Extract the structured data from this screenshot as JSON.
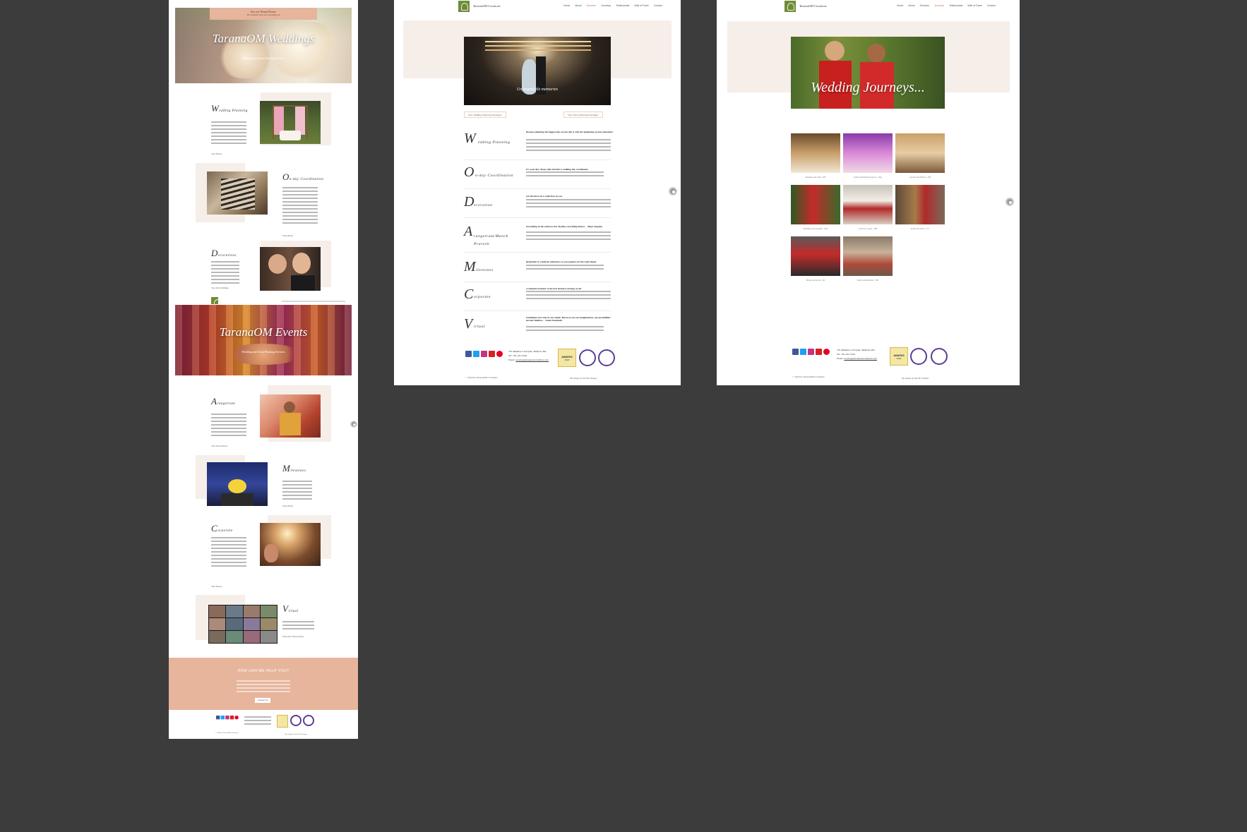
{
  "colors": {
    "background": "#3c3c3c",
    "peach": "#e6b59c",
    "blush": "#f6eee9",
    "logo_green": "#6f8b3a",
    "accent": "#c97b54",
    "badge_purple": "#5b3c96"
  },
  "panel1": {
    "banner_line1": "See our Virtual Events",
    "banner_line2": "Let us know how we can help you",
    "weddings_title": "TaranaOM Weddings",
    "weddings_sub": "Wedding and Event Planning Services",
    "events_title": "TaranaOM Events",
    "events_sub": "Wedding and Event Planning Services",
    "services": [
      {
        "letter": "W",
        "rest": "edding Planning",
        "link": "View Photos"
      },
      {
        "letter": "O",
        "rest": "n-day Coordination",
        "link": "View Photos"
      },
      {
        "letter": "D",
        "rest": "ecorations",
        "link": "View Past Weddings"
      },
      {
        "letter": "A",
        "rest": "rangetram",
        "link": "View Past Services"
      },
      {
        "letter": "M",
        "rest": "ilestones",
        "link": "View Photos"
      },
      {
        "letter": "C",
        "rest": "orporate",
        "link": "View Photos"
      },
      {
        "letter": "V",
        "rest": "irtual",
        "link": "View Past Virtual Events"
      }
    ],
    "help_title": "HOW CAN WE HELP YOU?",
    "help_button": "Contact Us",
    "footer_copy": "© 2020 by TaranaOM Creations",
    "footer_credit": "Site design by Zina M's Designs"
  },
  "site": {
    "brand": "TaranaOM Creations",
    "nav": [
      "Home",
      "About",
      "Services",
      "Journeys",
      "Testimonials",
      "Wall of Fame",
      "Contact"
    ],
    "address": "765 Middlesex Turnpike, Bedford, MA",
    "tel": "Tel: 781-292-3546",
    "email_label": "Email:",
    "email": "anusha@taranaomcreations.com",
    "copyright": "© 2020 by TaranaOM Creations",
    "credit": "Site design by Zina M's Designs",
    "award": "AWARDS",
    "award_year": "2020"
  },
  "panel2": {
    "hero_caption": "Unforgettable memories",
    "btn_wedding": "View Wedding Planning Packages",
    "btn_event": "View Event Planning Packages",
    "services": [
      {
        "letter": "W",
        "rest": "edding Planning",
        "quote": "Because planning the biggest day of your life is only the beginning of your adventure."
      },
      {
        "letter": "O",
        "rest": "n-day Coordination",
        "quote": "It's your day! Keep calm and hire a wedding day coordinator."
      },
      {
        "letter": "D",
        "rest": "ecoration",
        "quote": "Get the décor be a reflection of you."
      },
      {
        "letter": "A",
        "rest": "rangetram/Manch Pravesh",
        "quote": "Everything in the universe has rhythm, everything dances. - Maya Angelou"
      },
      {
        "letter": "M",
        "rest": "ilestones",
        "quote": "Remember to celebrate milestones as you prepare for the road ahead."
      },
      {
        "letter": "C",
        "rest": "orporate",
        "quote": "A satisfied customer is the best business strategy of all."
      },
      {
        "letter": "V",
        "rest": "irtual",
        "quote": "Limitations live only in our minds. But if we use our imaginations, our possibilities become limitless. - Jamie Paolinetti"
      }
    ]
  },
  "panel3": {
    "hero_title": "Wedding Journeys...",
    "captions": [
      "Manisha and Abhi - NH",
      "Indian Wedding Reception - MA",
      "Aparna and Patrick - NH",
      "Prathima and Jonathan - MA",
      "A Sweet Couple - NH",
      "Rohit and Jason - VT",
      "Hema and Kevin - RI",
      "Rohit and Monisha - NH"
    ]
  }
}
